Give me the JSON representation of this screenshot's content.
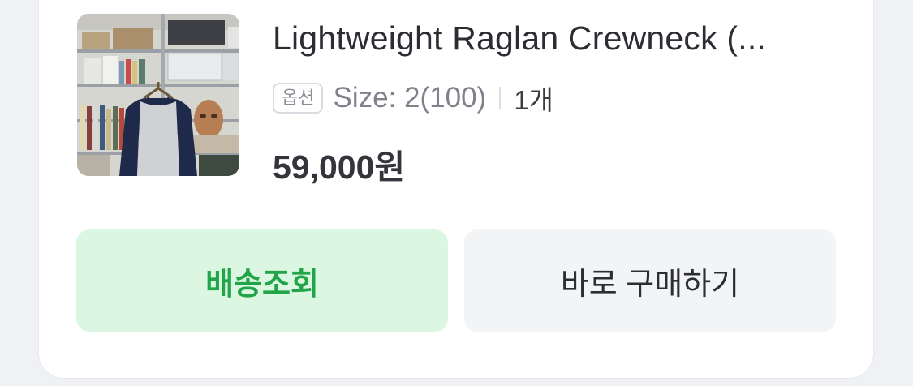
{
  "product": {
    "title": "Lightweight Raglan Crewneck (...",
    "option_badge": "옵션",
    "option_value": "Size: 2(100)",
    "quantity": "1개",
    "price": "59,000원"
  },
  "actions": {
    "track_label": "배송조회",
    "buy_label": "바로 구매하기"
  },
  "colors": {
    "track_bg": "#dbf7e2",
    "track_text": "#22a548",
    "buy_bg": "#f3f4f6"
  }
}
